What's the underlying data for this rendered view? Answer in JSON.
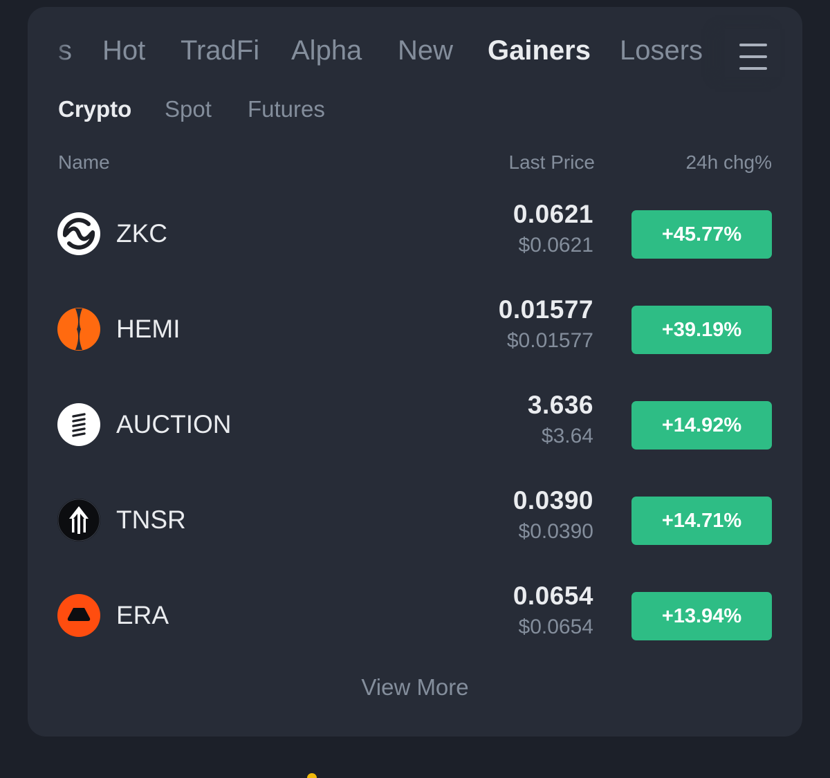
{
  "tabs": [
    {
      "label": "s",
      "active": false
    },
    {
      "label": "Hot",
      "active": false
    },
    {
      "label": "TradFi",
      "active": false
    },
    {
      "label": "Alpha",
      "active": false
    },
    {
      "label": "New",
      "active": false
    },
    {
      "label": "Gainers",
      "active": true
    },
    {
      "label": "Losers",
      "active": false
    }
  ],
  "menu_icon": "hamburger-menu-icon",
  "subtabs": [
    {
      "label": "Crypto",
      "active": true
    },
    {
      "label": "Spot",
      "active": false
    },
    {
      "label": "Futures",
      "active": false
    }
  ],
  "columns": {
    "name": "Name",
    "last_price": "Last Price",
    "change": "24h chg%"
  },
  "rows": [
    {
      "symbol": "ZKC",
      "price": "0.0621",
      "price_usd": "$0.0621",
      "change": "+45.77%",
      "icon": "zkc-logo-icon"
    },
    {
      "symbol": "HEMI",
      "price": "0.01577",
      "price_usd": "$0.01577",
      "change": "+39.19%",
      "icon": "hemi-logo-icon"
    },
    {
      "symbol": "AUCTION",
      "price": "3.636",
      "price_usd": "$3.64",
      "change": "+14.92%",
      "icon": "auction-logo-icon"
    },
    {
      "symbol": "TNSR",
      "price": "0.0390",
      "price_usd": "$0.0390",
      "change": "+14.71%",
      "icon": "tnsr-logo-icon"
    },
    {
      "symbol": "ERA",
      "price": "0.0654",
      "price_usd": "$0.0654",
      "change": "+13.94%",
      "icon": "era-logo-icon"
    }
  ],
  "view_more": "View More",
  "colors": {
    "background": "#1c2029",
    "card": "#272c37",
    "text_primary": "#eaecef",
    "text_secondary": "#848e9c",
    "gain": "#2ebd85",
    "hemi_orange": "#ff6a10",
    "era_orange": "#ff4d0f",
    "accent_yellow": "#f0b90b"
  }
}
